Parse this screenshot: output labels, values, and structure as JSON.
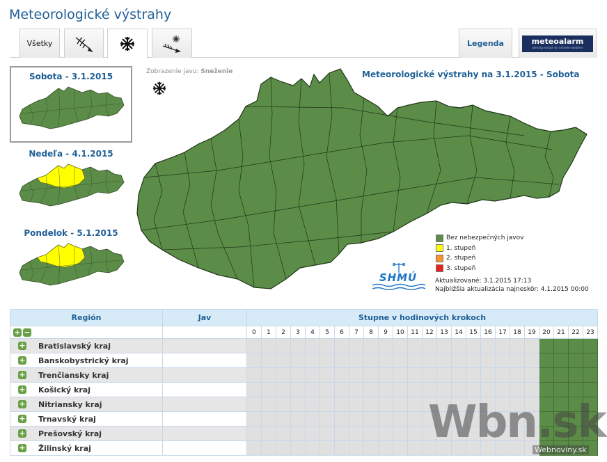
{
  "page": {
    "title": "Meteorologické výstrahy"
  },
  "tabs": {
    "all_label": "Všetky",
    "wind_icon": "wind-icon",
    "snow_icon": "snowflake-icon",
    "blizzard_icon": "blizzard-icon",
    "legend_label": "Legenda",
    "meteoalarm_label": "meteoalarm",
    "meteoalarm_tagline": "alerting europe for extreme weather"
  },
  "thumbnails": [
    {
      "title": "Sobota - 3.1.2015",
      "selected": true
    },
    {
      "title": "Nedeľa - 4.1.2015",
      "selected": false
    },
    {
      "title": "Pondelok - 5.1.2015",
      "selected": false
    }
  ],
  "phenomenon": {
    "label": "Zobrazenie javu:",
    "value": "Sneženie"
  },
  "map": {
    "title": "Meteorologické výstrahy na 3.1.2015 - Sobota"
  },
  "legend": [
    {
      "label": "Bez nebezpečných javov",
      "color": "#5b8c48"
    },
    {
      "label": "1. stupeň",
      "color": "#ffff00"
    },
    {
      "label": "2. stupeň",
      "color": "#f7932c"
    },
    {
      "label": "3. stupeň",
      "color": "#e8231d"
    }
  ],
  "logo": {
    "text": "SHMÚ"
  },
  "updates": {
    "updated_label": "Aktualizované:",
    "updated_value": "3.1.2015 17:13",
    "next_label": "Najbližšia aktualizácia najneskôr:",
    "next_value": "4.1.2015 00:00"
  },
  "table": {
    "col_region": "Región",
    "col_phenomenon": "Jav",
    "col_hours": "Stupne v hodinových krokoch",
    "hours": [
      "0",
      "1",
      "2",
      "3",
      "4",
      "5",
      "6",
      "7",
      "8",
      "9",
      "10",
      "11",
      "12",
      "13",
      "14",
      "15",
      "16",
      "17",
      "18",
      "19",
      "20",
      "21",
      "22",
      "23"
    ],
    "green_from_hour": 20,
    "regions": [
      "Bratislavský kraj",
      "Banskobystrický kraj",
      "Trenčiansky kraj",
      "Košický kraj",
      "Nitriansky kraj",
      "Trnavský kraj",
      "Prešovský kraj",
      "Žilinský kraj"
    ]
  },
  "watermark": {
    "text": "Wbn.sk",
    "sub": "Webnoviny.sk"
  }
}
